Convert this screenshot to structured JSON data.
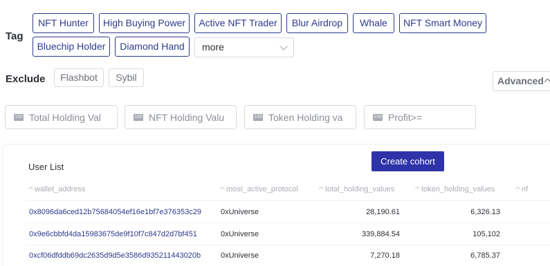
{
  "tag": {
    "label": "Tag",
    "items": [
      "NFT Hunter",
      "High Buying Power",
      "Active NFT Trader",
      "Blur Airdrop",
      "Whale",
      "NFT Smart Money",
      "Bluechip Holder",
      "Diamond Hand"
    ],
    "more_select": "more"
  },
  "exclude": {
    "label": "Exclude",
    "items": [
      "Flashbot",
      "Sybil"
    ]
  },
  "advanced_label": "Advanced",
  "filters": [
    {
      "placeholder": "Total Holding Val",
      "icon": "number-icon",
      "icon_text": "100"
    },
    {
      "placeholder": "NFT Holding Valu",
      "icon": "number-icon",
      "icon_text": "100"
    },
    {
      "placeholder": "Token Holding va",
      "icon": "number-icon",
      "icon_text": "100"
    },
    {
      "placeholder": "Profit>=",
      "icon": "number-icon",
      "icon_text": "100"
    }
  ],
  "user_list": {
    "title": "User List",
    "create_button": "Create cohort",
    "columns": [
      "wallet_address",
      "most_active_protocol",
      "total_holding_values",
      "token_holding_values",
      "nf"
    ],
    "rows": [
      {
        "wallet_address": "0x8096da6ced12b75684054ef16e1bf7e376353c29",
        "protocol": "0xUniverse",
        "total": "28,190.61",
        "token": "6,326.13"
      },
      {
        "wallet_address": "0x9e6cbbfd4da15983675de9f10f7c847d2d7bf451",
        "protocol": "0xUniverse",
        "total": "339,884.54",
        "token": "105,102"
      },
      {
        "wallet_address": "0xcf06dfddb69dc2635d9d5e3586d935211443020b",
        "protocol": "0xUniverse",
        "total": "7,270.18",
        "token": "6,785.37"
      }
    ]
  },
  "colors": {
    "accent": "#2d3a8c",
    "button": "#2f33a8",
    "border": "#d9dbe0"
  }
}
